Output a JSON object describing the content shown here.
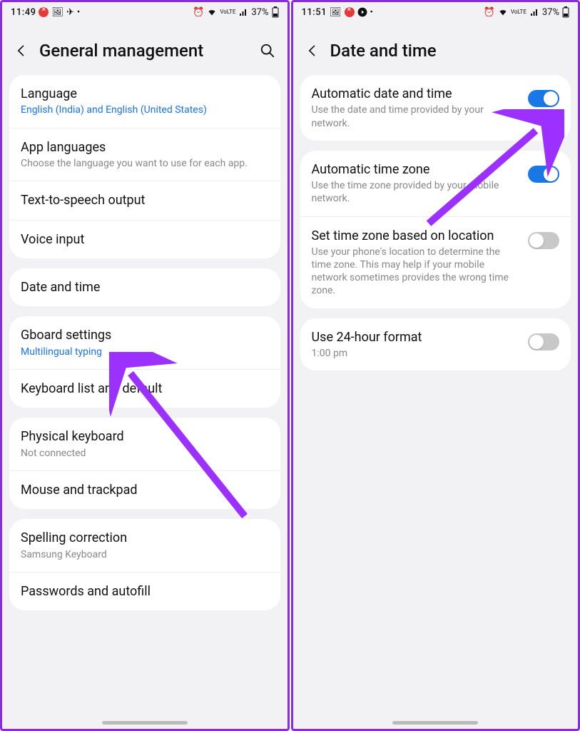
{
  "left": {
    "status": {
      "time": "11:49",
      "battery": "37%"
    },
    "header": {
      "title": "General management"
    },
    "groups": [
      {
        "rows": [
          {
            "title": "Language",
            "sub": "English (India) and English (United States)",
            "subBlue": true
          },
          {
            "title": "App languages",
            "sub": "Choose the language you want to use for each app."
          },
          {
            "title": "Text-to-speech output"
          },
          {
            "title": "Voice input"
          }
        ]
      },
      {
        "rows": [
          {
            "title": "Date and time"
          }
        ]
      },
      {
        "rows": [
          {
            "title": "Gboard settings",
            "sub": "Multilingual typing",
            "subBlue": true
          },
          {
            "title": "Keyboard list and default"
          }
        ]
      },
      {
        "rows": [
          {
            "title": "Physical keyboard",
            "sub": "Not connected"
          },
          {
            "title": "Mouse and trackpad"
          }
        ]
      },
      {
        "rows": [
          {
            "title": "Spelling correction",
            "sub": "Samsung Keyboard"
          },
          {
            "title": "Passwords and autofill"
          }
        ]
      }
    ]
  },
  "right": {
    "status": {
      "time": "11:51",
      "battery": "37%"
    },
    "header": {
      "title": "Date and time"
    },
    "groups": [
      {
        "rows": [
          {
            "title": "Automatic date and time",
            "sub": "Use the date and time provided by your network.",
            "toggle": "on"
          }
        ]
      },
      {
        "rows": [
          {
            "title": "Automatic time zone",
            "sub": "Use the time zone provided by your mobile network.",
            "toggle": "on"
          },
          {
            "title": "Set time zone based on location",
            "sub": "Use your phone's location to determine the time zone. This may help if your mobile network sometimes provides the wrong time zone.",
            "toggle": "off"
          }
        ]
      },
      {
        "rows": [
          {
            "title": "Use 24-hour format",
            "sub": "1:00 pm",
            "toggle": "off"
          }
        ]
      }
    ]
  }
}
